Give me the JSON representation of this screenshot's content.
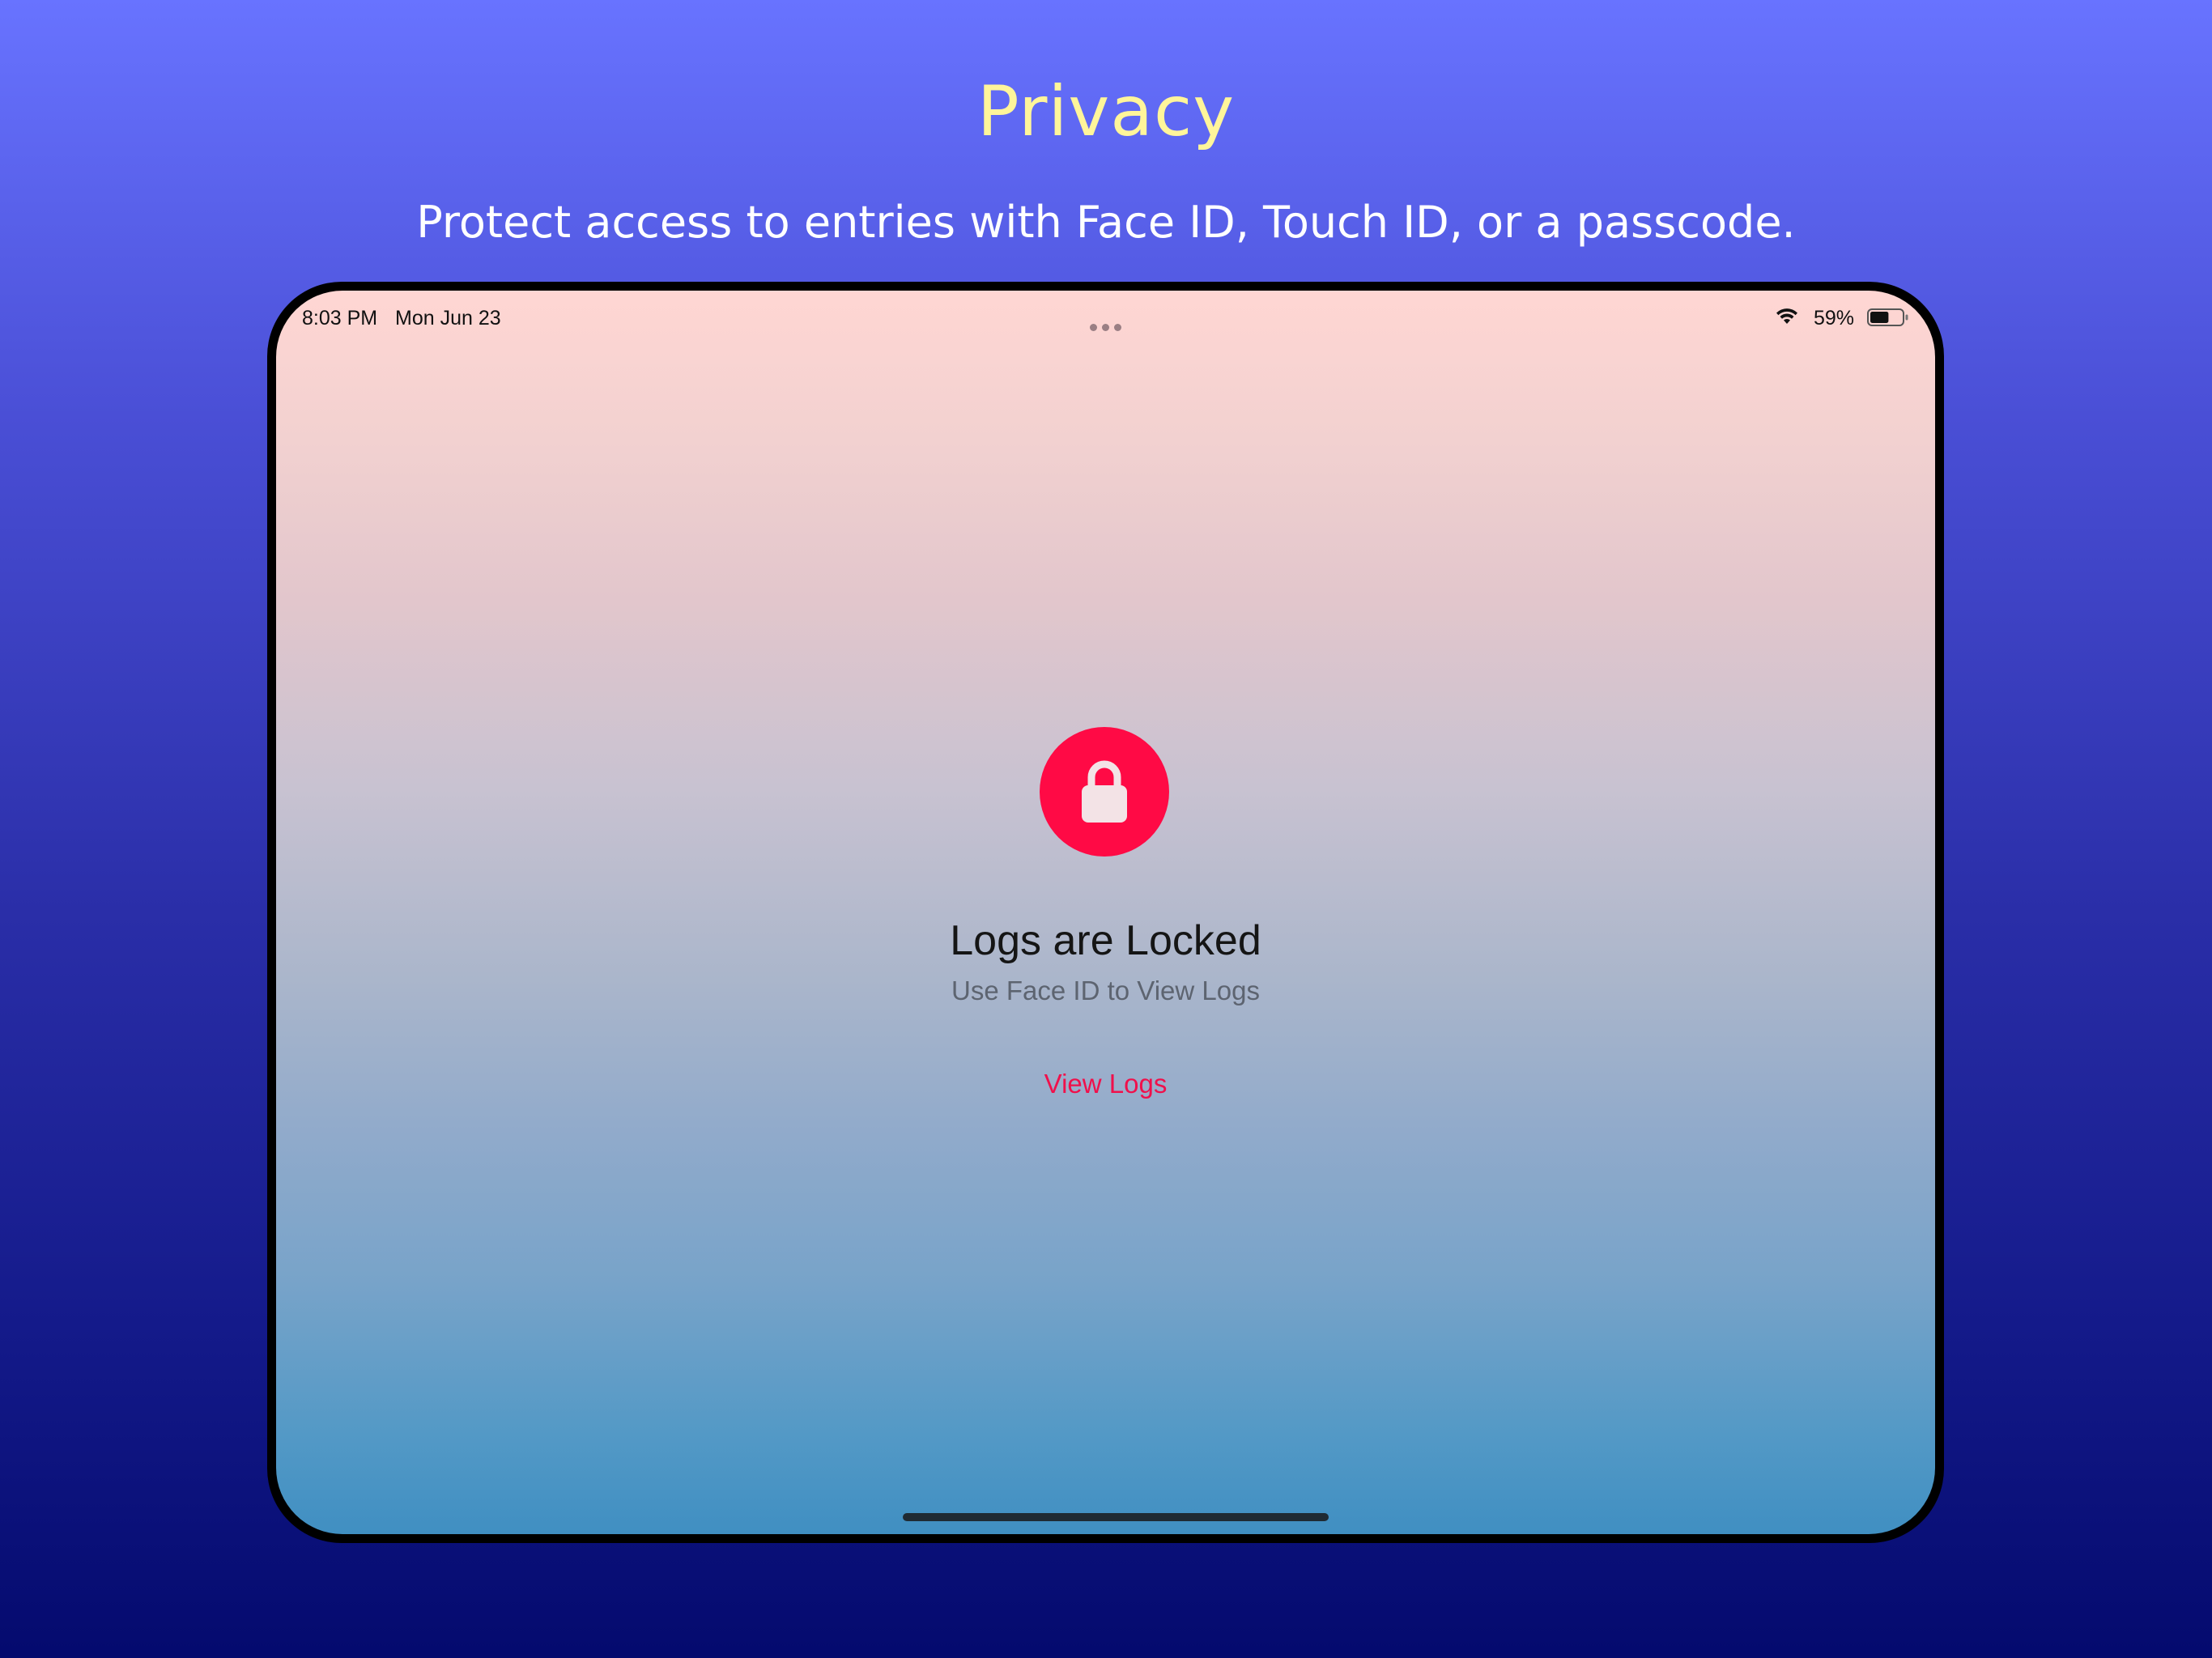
{
  "banner": {
    "title": "Privacy",
    "subtitle": "Protect access to entries with Face ID, Touch ID, or a passcode."
  },
  "status_bar": {
    "time": "8:03 PM",
    "date": "Mon Jun 23",
    "battery_percent": "59%",
    "battery_level": 0.59,
    "icons": [
      "multitasking-dots-icon",
      "wifi-icon",
      "battery-icon"
    ]
  },
  "lock_screen": {
    "icon": "lock-icon",
    "accent_color": "#ff0a45",
    "title": "Logs are Locked",
    "message": "Use Face ID to View Logs",
    "action_label": "View Logs"
  }
}
